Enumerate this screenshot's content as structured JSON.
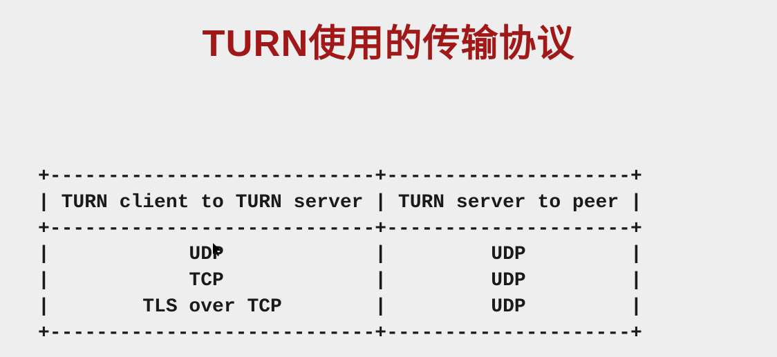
{
  "title": "TURN使用的传输协议",
  "chart_data": {
    "type": "table",
    "headers": [
      "TURN client to TURN server",
      "TURN server to peer"
    ],
    "rows": [
      [
        "UDP",
        "UDP"
      ],
      [
        "TCP",
        "UDP"
      ],
      [
        "TLS over TCP",
        "UDP"
      ]
    ]
  },
  "ascii": {
    "border_top": "+----------------------------+---------------------+",
    "header_row": "| TURN client to TURN server | TURN server to peer |",
    "border_mid": "+----------------------------+---------------------+",
    "row1": "|            UDP             |         UDP         |",
    "row2": "|            TCP             |         UDP         |",
    "row3": "|        TLS over TCP        |         UDP         |",
    "border_bottom": "+----------------------------+---------------------+"
  },
  "cursor_glyph": "➤"
}
